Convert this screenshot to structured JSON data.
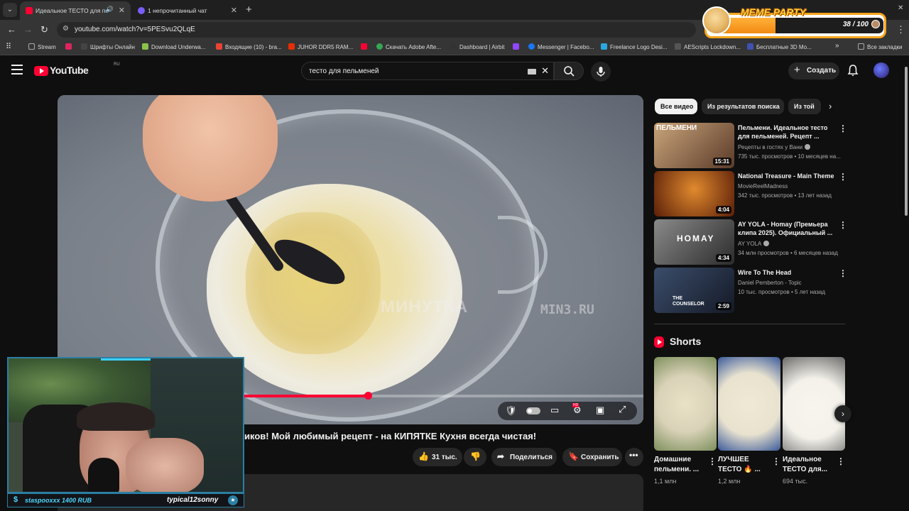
{
  "browser": {
    "tabs": [
      {
        "title": "Идеальное ТЕСТО для пе",
        "active": true,
        "favicon_color": "#ff0033"
      },
      {
        "title": "1 непрочитанный чат",
        "active": false,
        "favicon_color": "#7a5cff"
      }
    ],
    "url": "youtube.com/watch?v=5PESvu2QLqE",
    "bookmarks": [
      {
        "label": "Stream",
        "icon": "folder-icon",
        "color": "#aaaaaa"
      },
      {
        "label": "",
        "icon": "live-icon",
        "color": "#e0245e"
      },
      {
        "label": "Шрифты Онлайн",
        "icon": "font-icon",
        "color": "#444444"
      },
      {
        "label": "Download Underwa...",
        "icon": "ae-icon",
        "color": "#8bc34a"
      },
      {
        "label": "Входящие (10) - bra...",
        "icon": "gmail-icon",
        "color": "#ea4335"
      },
      {
        "label": "JUHOR DDR5 RAM...",
        "icon": "aliexpress-icon",
        "color": "#e62e04"
      },
      {
        "label": "",
        "icon": "youtube-icon",
        "color": "#ff0033"
      },
      {
        "label": "Скачать Adobe Afte...",
        "icon": "download-icon",
        "color": "#34a853"
      },
      {
        "label": "Dashboard | Airbit",
        "icon": "airbit-icon",
        "color": "#333333"
      },
      {
        "label": "",
        "icon": "twitch-icon",
        "color": "#9146ff"
      },
      {
        "label": "Messenger | Facebo...",
        "icon": "facebook-icon",
        "color": "#1877f2"
      },
      {
        "label": "Freelance Logo Desi...",
        "icon": "freelance-icon",
        "color": "#29a8e0"
      },
      {
        "label": "AEScripts Lockdown...",
        "icon": "aescripts-icon",
        "color": "#555555"
      },
      {
        "label": "Бесплатные 3D Мо...",
        "icon": "3d-icon",
        "color": "#3f51b5"
      }
    ],
    "all_bookmarks": "Все закладки"
  },
  "meme_widget": {
    "title": "MEME PARTY",
    "progress_text": "38 / 100",
    "progress_value": 0.38
  },
  "youtube": {
    "logo": "YouTube",
    "country": "RU",
    "search_query": "тесто для пельменей",
    "create_label": "Создать"
  },
  "video": {
    "watermark_1": "МИНУТКА",
    "watermark_2": "MIN3.RU",
    "progress": 0.53,
    "title": "иков! Мой любимый рецепт - на КИПЯТКЕ Кухня всегда чистая!",
    "likes": "31 тыс.",
    "share_label": "Поделиться",
    "save_label": "Сохранить"
  },
  "chips": [
    "Все видео",
    "Из результатов поиска",
    "Из той"
  ],
  "recommendations": [
    {
      "title": "Пельмени. Идеальное тесто для пельменей. Рецепт ...",
      "channel": "Рецепты в гостях у Вани",
      "verified": true,
      "meta": "735 тыс. просмотров • 10 месяцев на...",
      "duration": "15:31",
      "thumb_text": "ПЕЛЬМЕНИ",
      "thumb_colors": [
        "#c9a47a",
        "#5b3b2a"
      ]
    },
    {
      "title": "National Treasure - Main Theme",
      "channel": "MovieReelMadness",
      "verified": false,
      "meta": "342 тыс. просмотров • 13 лет назад",
      "duration": "4:04",
      "thumb_text": "",
      "thumb_colors": [
        "#e08a2e",
        "#5a1e08"
      ]
    },
    {
      "title": "AY YOLA - Homay (Премьера клипа 2025). Официальный ...",
      "channel": "AY YOLA",
      "verified": true,
      "meta": "34 млн просмотров • 6 месяцев назад",
      "duration": "4:34",
      "thumb_text": "HOMAY",
      "thumb_colors": [
        "#8a8a8a",
        "#2c2c2c"
      ]
    },
    {
      "title": "Wire To The Head",
      "channel": "Daniel Pemberton - Topic",
      "verified": false,
      "meta": "10 тыс. просмотров • 5 лет назад",
      "duration": "2:59",
      "thumb_text": "THE COUNSELOR",
      "thumb_colors": [
        "#3b4d6b",
        "#141a26"
      ]
    }
  ],
  "shorts": {
    "title": "Shorts",
    "items": [
      {
        "title": "Домашние пельмени. ...",
        "views": "1,1 млн",
        "thumb_colors": [
          "#d9d2b8",
          "#7d8f5c"
        ]
      },
      {
        "title": "ЛУЧШЕЕ ТЕСТО 🔥 ...",
        "views": "1,2 млн",
        "thumb_colors": [
          "#e8e2cf",
          "#3b5a9a"
        ]
      },
      {
        "title": "Идеальное ТЕСТО для...",
        "views": "694 тыс.",
        "thumb_colors": [
          "#f3f1ea",
          "#6a6a6a"
        ]
      }
    ]
  },
  "stream_overlay": {
    "donation": "staspooxxx 1400 RUB",
    "nickname": "typical12sonny"
  }
}
